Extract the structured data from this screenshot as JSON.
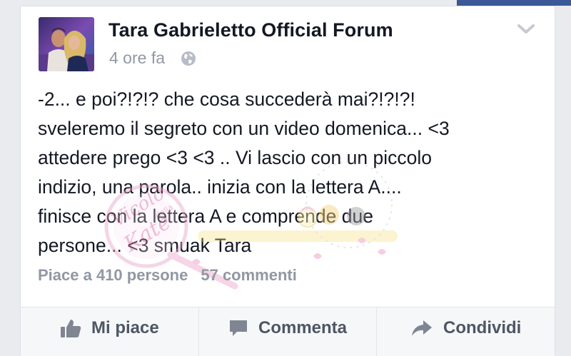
{
  "post": {
    "page_name": "Tara Gabrieletto Official Forum",
    "timestamp": "4 ore fa",
    "privacy_icon": "globe-icon",
    "lines": [
      "-2... e poi?!?!? che cosa succederà mai?!?!?!",
      "sveleremo il segreto con un video domenica... <3",
      "attedere prego <3 <3 .. Vi lascio con un piccolo",
      "indizio, una parola.. inizia con la lettera A....",
      "finisce con la lettera A e comprende due",
      "persone... <3 smuak Tara"
    ],
    "likes_text": "Piace a 410 persone",
    "comments_text": "57 commenti"
  },
  "actions": {
    "like": "Mi piace",
    "comment": "Commenta",
    "share": "Condividi"
  },
  "colors": {
    "brand": "#3b5998",
    "text": "#141823",
    "muted": "#9197a3",
    "action_text": "#4e5665",
    "watermark": "#e9a3c8"
  },
  "watermark_text": {
    "main": "Vicolo della Kate",
    "sub": "Vicolo della Kate nel web"
  }
}
